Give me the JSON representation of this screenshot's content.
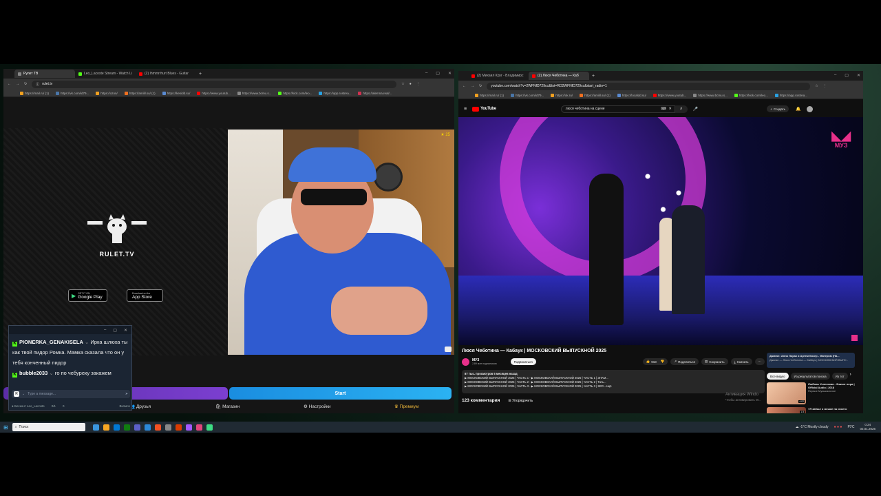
{
  "left_browser": {
    "tabs": [
      {
        "label": "Рулет ТВ",
        "active": true,
        "color": "#888888"
      },
      {
        "label": "Leo_Lacoste Stream - Watch Li",
        "active": false,
        "color": "#53fc18"
      },
      {
        "label": "(2) Ihmmrrhurt Blues - Guitar",
        "active": false,
        "color": "#ff0000"
      }
    ],
    "url": "rulet.tv",
    "bookmarks": [
      "https://mail.ru/ (1)",
      "https://vk.com/id79...",
      "https://ozon/",
      "https://amilil.su/ (1)",
      "https://kesidd.su/",
      "https://www.youtub...",
      "https://www.bcmu.s...",
      "https://kick.com/leo...",
      "https://app.rostrea...",
      "https://alemna.real/..."
    ],
    "logo_text": "RULET.TV",
    "store_buttons": {
      "google": {
        "small": "GET IT ON",
        "big": "Google Play"
      },
      "apple": {
        "small": "Download on the",
        "big": "App Store"
      }
    },
    "bottom_nav": {
      "friends": "Друзья",
      "shop": "Магазин",
      "settings": "Настройки",
      "premium": "Премиум"
    },
    "start_button": "Start",
    "favorite_count": "25"
  },
  "chat": {
    "messages": [
      {
        "user": "PIONERKA_GENAKISELA",
        "text": "Ирка шлюха ты как твой пидор Ромка. Мамка сказала что он у тебя конченный пидор"
      },
      {
        "user": "bubble2033",
        "text": "го по чебуреку закажем"
      }
    ],
    "input_placeholder": "Type a message...",
    "footer_user": "Бесконт Leo_Lacoste",
    "footer_counts": [
      "0/1",
      "0"
    ],
    "footer_right": "Вклмоч"
  },
  "right_browser": {
    "tabs": [
      {
        "label": "(2) Михаил Круг - Владимирс",
        "active": false,
        "color": "#ff0000"
      },
      {
        "label": "(2) Люся Чеботина — Каб",
        "active": true,
        "color": "#ff0000"
      }
    ],
    "url": "youtube.com/watch?v=2WFNfD729cc&list=RD2WFNfD729cc&start_radio=1",
    "bookmarks": [
      "https://mail.ru/ (1)",
      "https://vk.com/id79...",
      "https://ok.ru/",
      "https://amilil.su/ (1)",
      "https://localdd.su/",
      "https://www.youtub...",
      "https://www.bcmu.s...",
      "https://kick.com/leo...",
      "https://app.rostrea..."
    ],
    "search_query": "люся чеботина на сцене",
    "create_button": "Создать",
    "logo": "YouTube",
    "video": {
      "channel_watermark": "МУЗ",
      "title": "Люся Чеботина — Кабаук | МОСКОВСКИЙ ВЫПУСКНОЙ 2025",
      "channel": "МУЗ",
      "subscribers": "2,89 млн подписчиков",
      "subscribe": "Подписаться",
      "likes": "918",
      "share": "Поделиться",
      "save": "Сохранить",
      "download": "Скачать",
      "views": "87 тыс. просмотров  5 месяцев назад",
      "description": [
        "▶ МОСКОВСКИЙ ВЫПУСКНОЙ 2025 | ЧАСТЬ 1 - ▶ МОСКОВСКИЙ ВЫПУСКНОЙ 2025 | ЧАСТЬ 1 | ЗНАМ...",
        "▶ МОСКОВСКИЙ ВЫПУСКНОЙ 2025 | ЧАСТЬ 2 - ▶ МОСКОВСКИЙ ВЫПУСКНОЙ 2025 | ЧАСТЬ 2 | Тать...",
        "▶ МОСКОВСКИЙ ВЫПУСКНОЙ 2025 | ЧАСТЬ 3 - ▶ МОСКОВСКИЙ ВЫПУСКНОЙ 2025 | ЧАСТЬ 3 | SER...ещё"
      ],
      "comments": "123 комментария",
      "sort": "Упорядочить"
    },
    "playlist": {
      "title": "Джиган: Анна Лорак и Артем Качер - Матерям (На...",
      "subtitle": "Джиган — Люся Чеботина — Кабаук | МОСКОВСКИЙ ВЫПУ..."
    },
    "chips": [
      "Все видео",
      "Из результатов поиска",
      "Из тот"
    ],
    "recommend": {
      "title": "Любовь Успенская - Значит пора | Official Audio | 2018",
      "channel": "Первое Музыкальное",
      "duration": "4:02"
    },
    "recommend2": {
      "title": "«Я забыл о мешке на своего",
      "duration": "1:3"
    },
    "activation": [
      "Активация Windo",
      "Чтобы активировать W..."
    ]
  },
  "taskbar": {
    "search_placeholder": "Поиск",
    "weather": "-1°C  Mostly cloudy",
    "lang": "РУС",
    "time": "0:24",
    "date": "02.01.2026"
  }
}
